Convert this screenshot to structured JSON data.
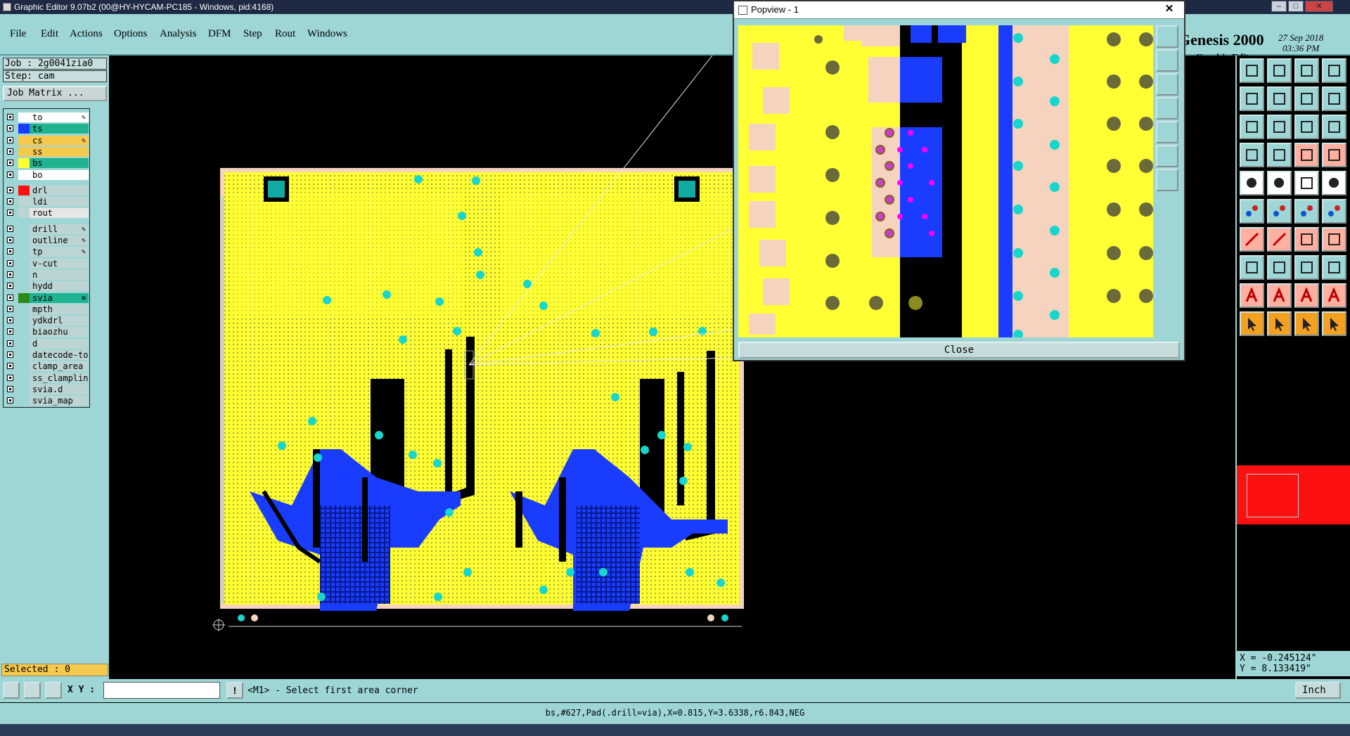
{
  "window": {
    "title": "Graphic Editor 9.07b2 (00@HY-HYCAM-PC185 - Windows, pid:4168)"
  },
  "menu": [
    "File",
    "Edit",
    "Actions",
    "Options",
    "Analysis",
    "DFM",
    "Step",
    "Rout",
    "Windows"
  ],
  "brand": {
    "product": "Genesis 2000",
    "subtitle": "Graphic Editor",
    "date": "27 Sep 2018",
    "time": "03:36 PM"
  },
  "job": {
    "job_label": "Job : 2g0041zia0",
    "step_label": "Step: cam",
    "job_matrix_button": "Job Matrix ..."
  },
  "layers": [
    {
      "name": "to",
      "color": "#ffffff",
      "swatch": "#ffffff",
      "flag": "✎"
    },
    {
      "name": "ts",
      "color": "#1fb38f",
      "swatch": "#1a3cff",
      "flag": ""
    },
    {
      "name": "cs",
      "color": "#f4c94e",
      "swatch": "#f4c94e",
      "flag": "✎"
    },
    {
      "name": "ss",
      "color": "#f4c94e",
      "swatch": "#f4c94e",
      "flag": ""
    },
    {
      "name": "bs",
      "color": "#1fb38f",
      "swatch": "#ffff33",
      "flag": ""
    },
    {
      "name": "bo",
      "color": "#ffffff",
      "swatch": "#ffffff",
      "flag": ""
    },
    {
      "name": "drl",
      "color": "#bcd4d4",
      "swatch": "#ff1010",
      "flag": ""
    },
    {
      "name": "ldi",
      "color": "#bcd4d4",
      "swatch": "#bcd4d4",
      "flag": ""
    },
    {
      "name": "rout",
      "color": "#e6e6e6",
      "swatch": "#bcd4d4",
      "flag": ""
    },
    {
      "name": "drill",
      "color": "#bcd4d4",
      "swatch": "#9ed6d6",
      "flag": "✎"
    },
    {
      "name": "outline",
      "color": "#bcd4d4",
      "swatch": "#9ed6d6",
      "flag": "✎"
    },
    {
      "name": "tp",
      "color": "#bcd4d4",
      "swatch": "#9ed6d6",
      "flag": "✎"
    },
    {
      "name": "v-cut",
      "color": "#bcd4d4",
      "swatch": "#9ed6d6",
      "flag": ""
    },
    {
      "name": "n",
      "color": "#bcd4d4",
      "swatch": "#9ed6d6",
      "flag": ""
    },
    {
      "name": "hydd",
      "color": "#bcd4d4",
      "swatch": "#9ed6d6",
      "flag": ""
    },
    {
      "name": "svia",
      "color": "#1fb38f",
      "swatch": "#2c8a1a",
      "flag": "≡"
    },
    {
      "name": "mpth",
      "color": "#bcd4d4",
      "swatch": "#9ed6d6",
      "flag": ""
    },
    {
      "name": "ydkdrl",
      "color": "#bcd4d4",
      "swatch": "#9ed6d6",
      "flag": ""
    },
    {
      "name": "biaozhu",
      "color": "#bcd4d4",
      "swatch": "#9ed6d6",
      "flag": ""
    },
    {
      "name": "d",
      "color": "#bcd4d4",
      "swatch": "#9ed6d6",
      "flag": ""
    },
    {
      "name": "datecode-to",
      "color": "#bcd4d4",
      "swatch": "#9ed6d6",
      "flag": ""
    },
    {
      "name": "clamp_area",
      "color": "#bcd4d4",
      "swatch": "#9ed6d6",
      "flag": ""
    },
    {
      "name": "ss_clampline",
      "color": "#bcd4d4",
      "swatch": "#9ed6d6",
      "flag": ""
    },
    {
      "name": "svia.d",
      "color": "#bcd4d4",
      "swatch": "#9ed6d6",
      "flag": ""
    },
    {
      "name": "svia_map",
      "color": "#bcd4d4",
      "swatch": "#9ed6d6",
      "flag": ""
    }
  ],
  "selected_label": "Selected : 0",
  "popview": {
    "title": "Popview - 1",
    "close_label": "Close"
  },
  "coords": {
    "x": "X = -0.245124\"",
    "y": "Y = 8.133419\""
  },
  "bottombar": {
    "xy_label": "X Y :",
    "xy_value": "",
    "prompt": "<M1> - Select first area corner",
    "unit": "Inch"
  },
  "status": "bs,#627,Pad(.drill=via),X=0.815,Y=3.6338,r6.843,NEG",
  "colors": {
    "panel": "#9ed6d6",
    "board_yellow": "#ffff33",
    "copper_blue": "#1a3cff",
    "pad_cyan": "#17d6cc",
    "pad_pink": "#f6d3bf",
    "highlight_red": "#ff1010"
  }
}
